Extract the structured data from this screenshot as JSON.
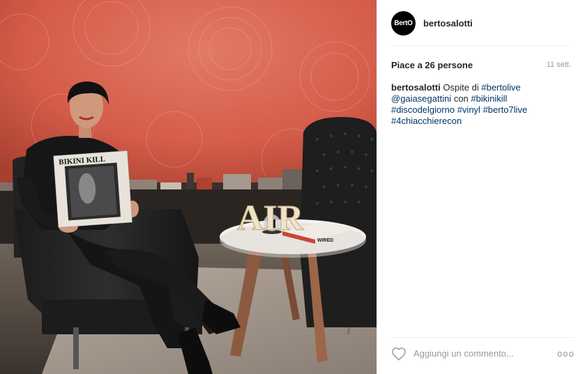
{
  "post": {
    "author": {
      "username": "bertosalotti",
      "avatar_text": "BertO"
    },
    "likes_text": "Piace a 26 persone",
    "time_text": "11 sett.",
    "caption": {
      "username": "bertosalotti",
      "text_before": "Ospite di",
      "tags": [
        "#bertolive",
        "@gaiasegattini",
        "#bikinikill",
        "#discodelgiorno",
        "#vinyl",
        "#berto7live",
        "#4chiacchierecon"
      ],
      "connector": "con"
    },
    "photo": {
      "album_title": "BIKINI KILL",
      "sign_text": "AIR",
      "magazine_text": "WIRED"
    },
    "comment": {
      "placeholder": "Aggiungi un commento...",
      "more_label": "ooo"
    }
  },
  "colors": {
    "wall": "#d9614f",
    "link": "#003569",
    "muted": "#999999",
    "text": "#262626"
  },
  "icons": {
    "like": "heart-icon",
    "more": "more-options-icon"
  }
}
